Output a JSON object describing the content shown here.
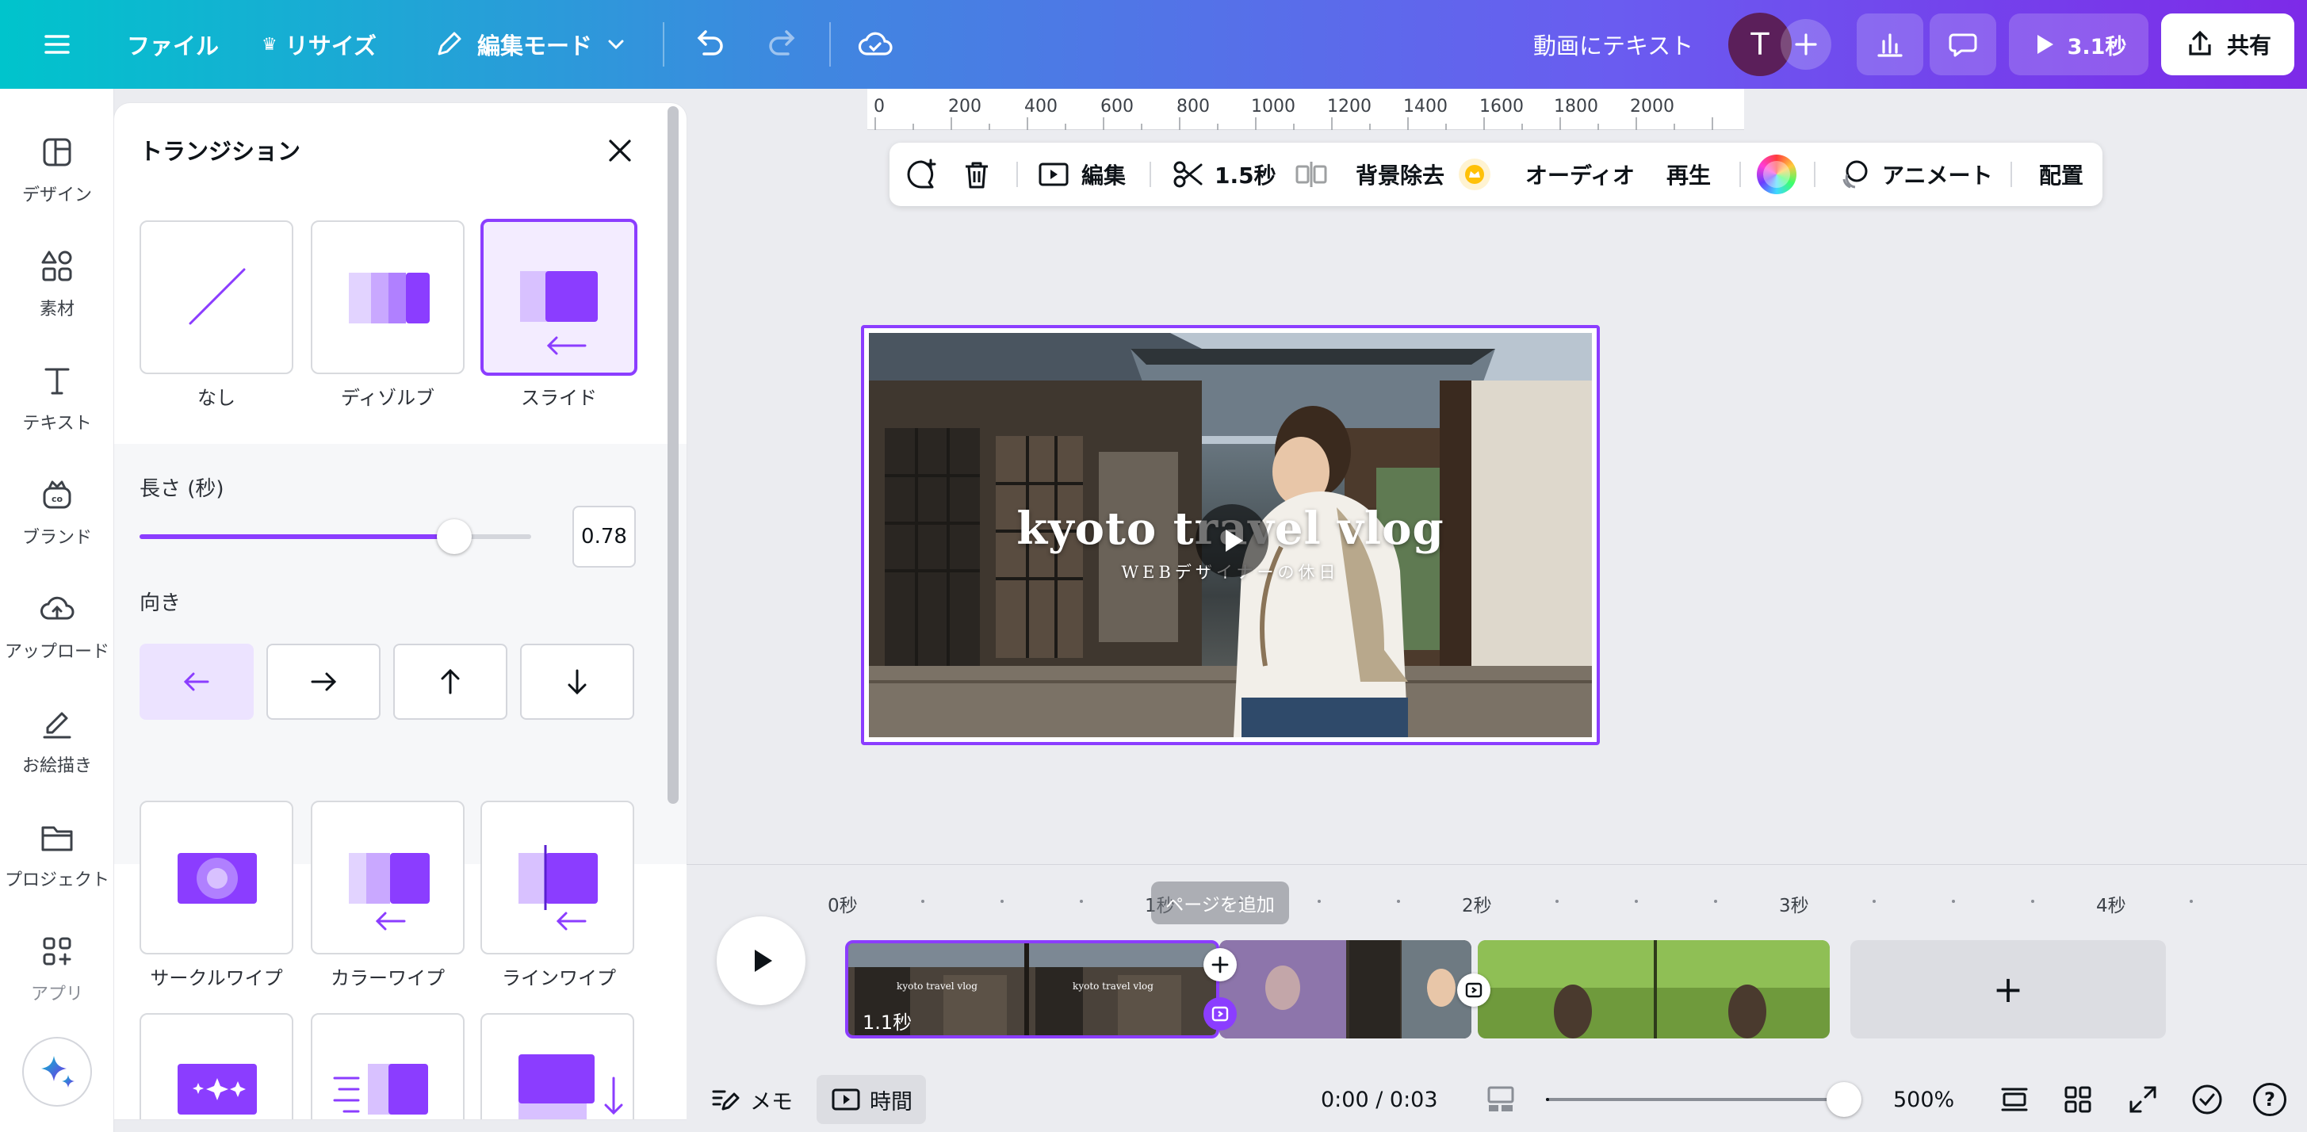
{
  "topbar": {
    "menu_icon": "hamburger-menu-icon",
    "file_label": "ファイル",
    "resize_label": "リサイズ",
    "edit_mode_label": "編集モード",
    "doc_title": "動画にテキスト",
    "avatar_initial": "T",
    "play_duration": "3.1秒",
    "share_label": "共有"
  },
  "rail": {
    "items": [
      {
        "label": "デザイン",
        "icon": "design-layout-icon"
      },
      {
        "label": "素材",
        "icon": "elements-shapes-icon"
      },
      {
        "label": "テキスト",
        "icon": "text-t-icon"
      },
      {
        "label": "ブランド",
        "icon": "brand-crown-icon"
      },
      {
        "label": "アップロード",
        "icon": "upload-cloud-icon"
      },
      {
        "label": "お絵描き",
        "icon": "draw-pen-icon"
      },
      {
        "label": "プロジェクト",
        "icon": "folder-icon"
      },
      {
        "label": "アプリ",
        "icon": "apps-grid-plus-icon"
      }
    ]
  },
  "panel": {
    "title": "トランジション",
    "row1": [
      {
        "label": "なし"
      },
      {
        "label": "ディゾルブ"
      },
      {
        "label": "スライド"
      }
    ],
    "length_label": "長さ (秒)",
    "length_value": "0.78",
    "length_fraction": 0.78,
    "direction_label": "向き",
    "directions": [
      "left",
      "right",
      "up",
      "down"
    ],
    "selected_direction": "left",
    "row2": [
      {
        "label": "サークルワイプ"
      },
      {
        "label": "カラーワイプ"
      },
      {
        "label": "ラインワイプ"
      }
    ]
  },
  "ruler": {
    "ticks": [
      "0",
      "200",
      "400",
      "600",
      "800",
      "1000",
      "1200",
      "1400",
      "1600",
      "1800",
      "2000"
    ]
  },
  "context_toolbar": {
    "edit_label": "編集",
    "duration_label": "1.5秒",
    "bg_remove_label": "背景除去",
    "audio_label": "オーディオ",
    "playback_label": "再生",
    "animate_label": "アニメート",
    "position_label": "配置"
  },
  "canvas": {
    "video_title": "kyoto travel vlog",
    "video_subtitle": "WEBデザイナーの休日"
  },
  "timeline": {
    "markers": [
      "0秒",
      "1秒",
      "2秒",
      "3秒",
      "4秒"
    ],
    "tooltip": "ページを追加",
    "clip1_duration": "1.1秒",
    "add_page_symbol": "+"
  },
  "bottombar": {
    "notes_label": "メモ",
    "timer_label": "時間",
    "time_display": "0:00 / 0:03",
    "zoom_label": "500%",
    "help_label": "?"
  },
  "colors": {
    "accent": "#8b3dff",
    "accent_light": "#c9a8ff",
    "selected_bg": "#ece3ff"
  }
}
